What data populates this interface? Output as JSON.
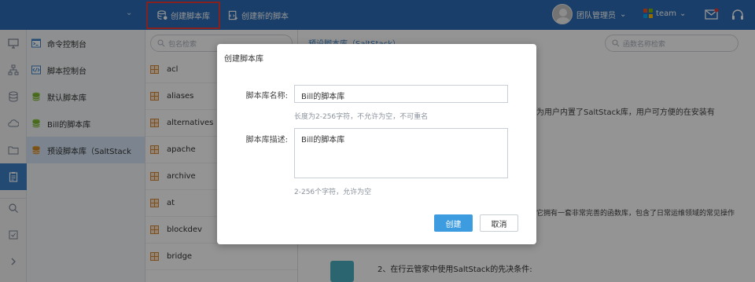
{
  "toolbar": {
    "create_library": "创建脚本库",
    "create_script": "创建新的脚本"
  },
  "user": {
    "name": "团队管理员",
    "team": "team"
  },
  "colors": {
    "topbar": "#2b6cb5",
    "accent": "#3d80c4",
    "highlight_border": "#e53935",
    "primary_button": "#3d9be0"
  },
  "nav": {
    "items": [
      {
        "label": "命令控制台",
        "icon": "terminal-icon"
      },
      {
        "label": "脚本控制台",
        "icon": "code-icon"
      },
      {
        "label": "默认脚本库",
        "icon": "database-icon"
      },
      {
        "label": "Bill的脚本库",
        "icon": "database-icon"
      },
      {
        "label": "预设脚本库（SaltStack",
        "icon": "database-icon"
      }
    ]
  },
  "list": {
    "search_placeholder": "包名检索",
    "items": [
      "acl",
      "aliases",
      "alternatives",
      "apache",
      "archive",
      "at",
      "blockdev",
      "bridge"
    ]
  },
  "main": {
    "search_placeholder": "函数名称检索",
    "breadcrumb": "预设脚本库（SaltStack）",
    "para1": "为用户内置了SaltStack库，用户可方便的在安装有",
    "para2": "它拥有一套非常完善的函数库，包含了日常运维领域的常见操作",
    "para3": "2、在行云管家中使用SaltStack的先决条件:"
  },
  "modal": {
    "title": "创建脚本库",
    "name_label": "脚本库名称:",
    "name_value": "Bill的脚本库",
    "name_hint": "长度为2-256字符，不允许为空，不可重名",
    "desc_label": "脚本库描述:",
    "desc_value": "Bill的脚本库",
    "desc_hint": "2-256个字符，允许为空",
    "ok": "创建",
    "cancel": "取消"
  }
}
